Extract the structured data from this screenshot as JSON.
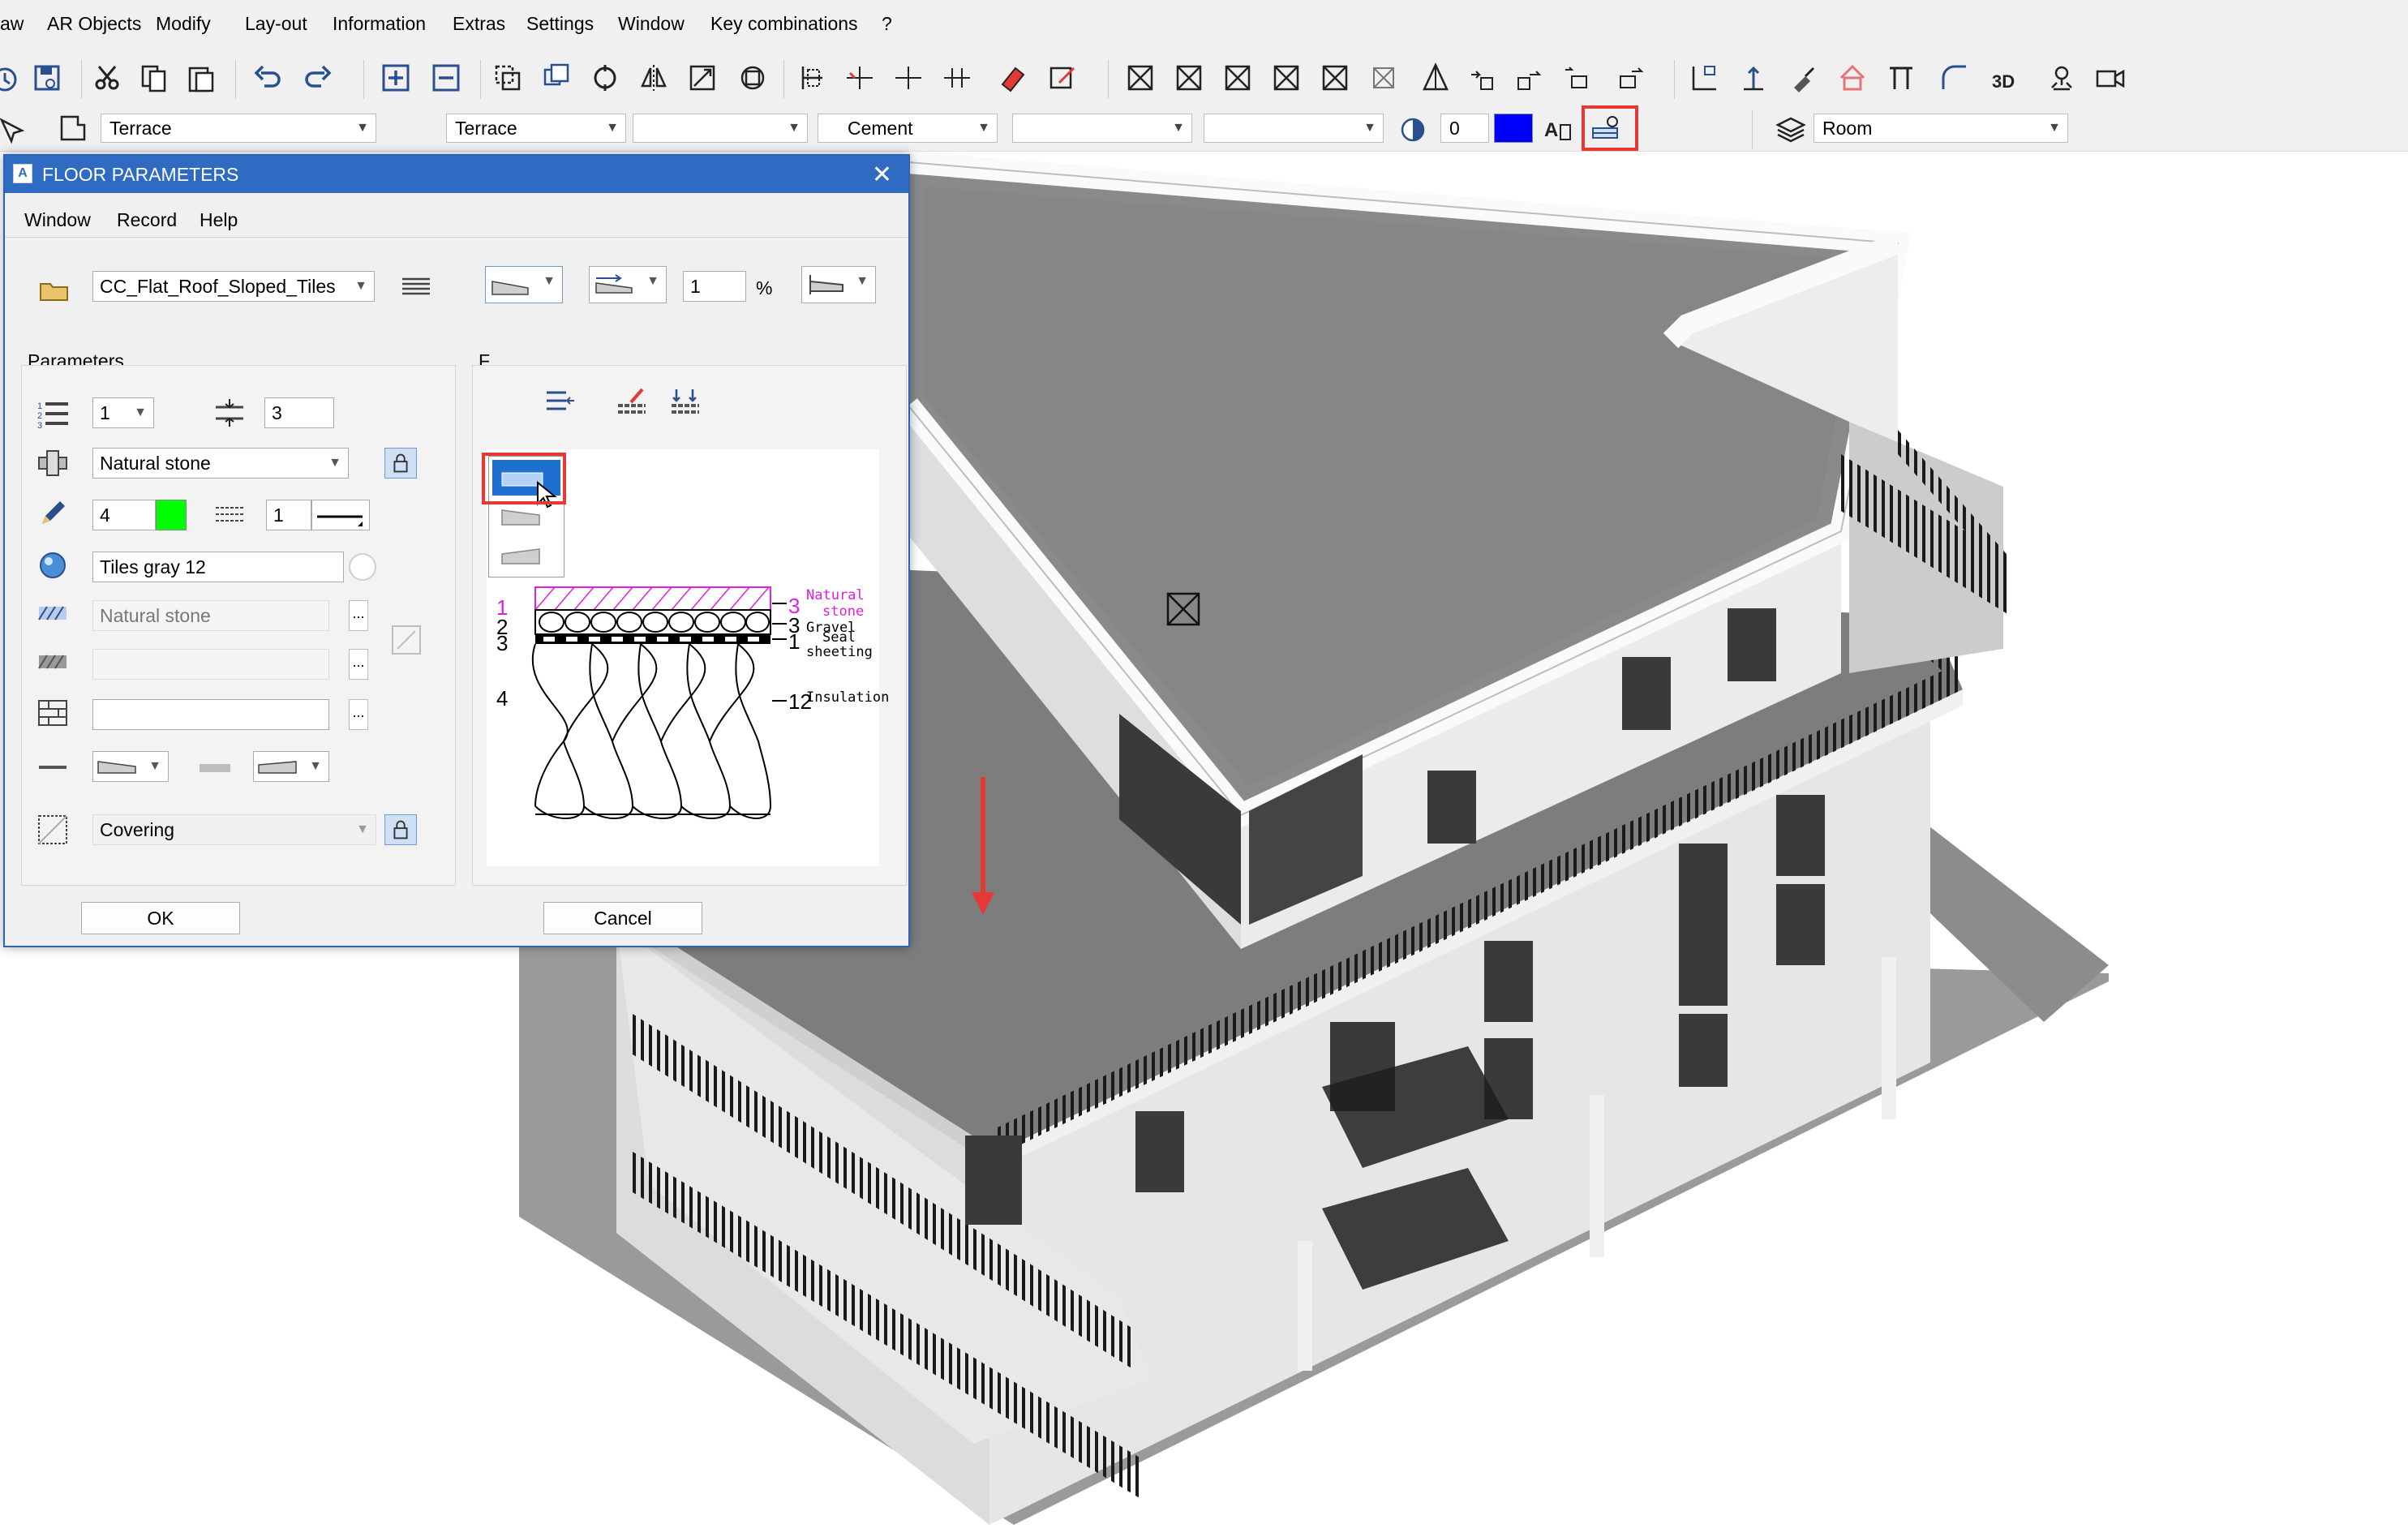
{
  "menu": {
    "items": [
      "aw",
      "AR Objects",
      "Modify",
      "Lay-out",
      "Information",
      "Extras",
      "Settings",
      "Window",
      "Key combinations",
      "?"
    ]
  },
  "toolbar2": {
    "layer_value": "Terrace",
    "surface_value": "Terrace",
    "material_value": "Cement",
    "zero_value": "0",
    "room_value": "Room",
    "color_swatch": "#0000ff"
  },
  "dialog": {
    "title": "FLOOR PARAMETERS",
    "close_glyph": "✕",
    "menu": [
      "Window",
      "Record",
      "Help"
    ],
    "favorite_value": "CC_Flat_Roof_Sloped_Tiles",
    "slope_value": "1",
    "slope_unit": "%",
    "parameters_label": "Parameters",
    "right_group_label": "F",
    "layer_count": "1",
    "thickness_value": "3",
    "material_value": "Natural stone",
    "pen_value": "4",
    "pen_color": "#00ff00",
    "line_value": "1",
    "texture_value": "Tiles gray 12",
    "hatch_value": "Natural stone",
    "hatch2_value": "",
    "pattern_value": "",
    "finish_value": "Covering",
    "ok_label": "OK",
    "cancel_label": "Cancel",
    "ellipsis": "..."
  },
  "preview": {
    "layers": [
      {
        "left_num": "1",
        "right_num": "3",
        "name": "Natural stone",
        "name_line2": "stone",
        "color": "#e020e0"
      },
      {
        "left_num": "2",
        "right_num": "3",
        "name": "Gravel",
        "color": "#000000"
      },
      {
        "left_num": "3",
        "right_num": "1",
        "name": "Seal sheeting",
        "color": "#000000"
      },
      {
        "left_num": "4",
        "right_num": "12",
        "name": "Insulation",
        "color": "#000000"
      }
    ],
    "name_natural": "Natural",
    "name_stone": "stone",
    "name_gravel": "Gravel",
    "name_seal": "Seal",
    "name_sheeting": "sheeting",
    "name_insulation": "Insulation"
  },
  "colors": {
    "title_bar": "#2f6bc2",
    "highlight": "#e53935",
    "selection": "#1f6fd1"
  }
}
